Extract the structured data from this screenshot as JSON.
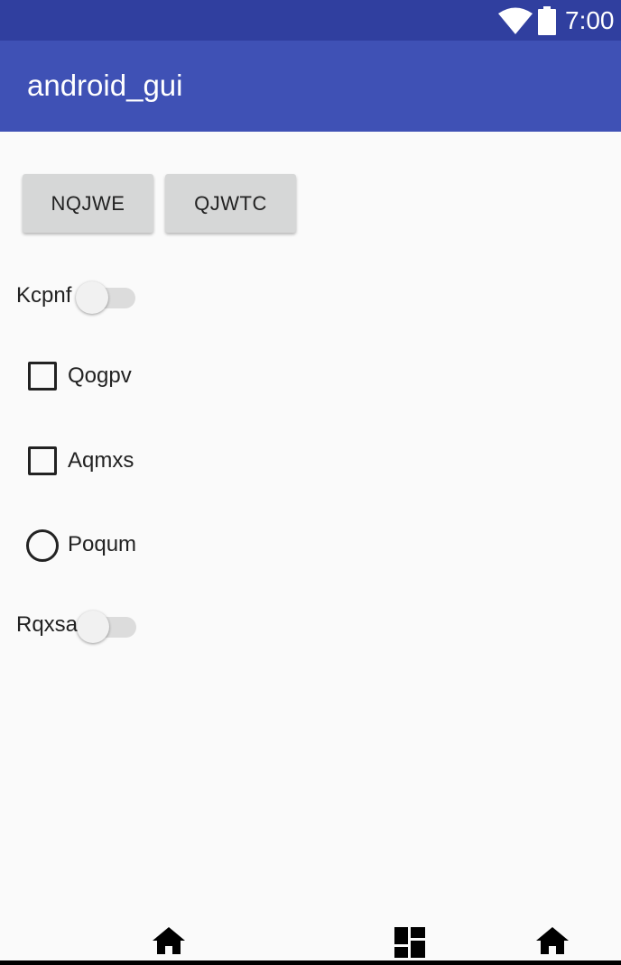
{
  "status_bar": {
    "time": "7:00",
    "icons": [
      "wifi-icon",
      "battery-icon"
    ],
    "color": "#303f9f"
  },
  "app_bar": {
    "title": "android_gui",
    "color": "#3f51b5"
  },
  "buttons": [
    {
      "label": "NQJWE"
    },
    {
      "label": "QJWTC"
    }
  ],
  "switches": [
    {
      "label": "Kcpnf",
      "checked": false
    },
    {
      "label": "Rqxsa",
      "checked": false
    }
  ],
  "checkboxes": [
    {
      "label": "Qogpv",
      "checked": false
    },
    {
      "label": "Aqmxs",
      "checked": false
    }
  ],
  "radios": [
    {
      "label": "Poqum",
      "checked": false
    }
  ],
  "nav_bar": {
    "icons": [
      "home-icon",
      "dashboard-icon",
      "home-icon"
    ]
  }
}
